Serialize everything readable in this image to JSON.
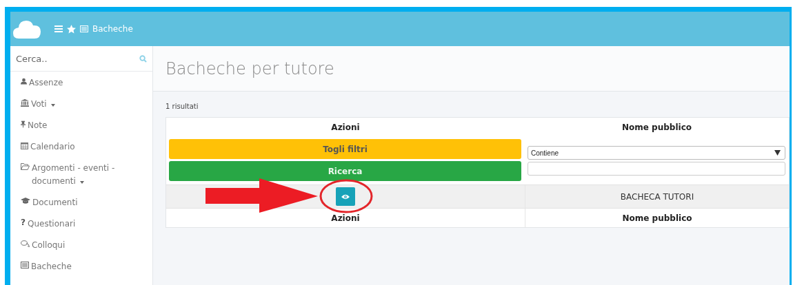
{
  "header": {
    "title": "Bacheche"
  },
  "sidebar": {
    "search": {
      "placeholder": "Cerca.."
    },
    "items": [
      {
        "label": "Assenze",
        "submenu": false
      },
      {
        "label": "Voti",
        "submenu": true
      },
      {
        "label": "Note",
        "submenu": false
      },
      {
        "label": "Calendario",
        "submenu": false
      },
      {
        "label": "Argomenti - eventi - documenti",
        "submenu": true
      },
      {
        "label": "Documenti",
        "submenu": false
      },
      {
        "label": "Questionari",
        "submenu": false,
        "glyph": "?"
      },
      {
        "label": "Colloqui",
        "submenu": false
      },
      {
        "label": "Bacheche",
        "submenu": false
      }
    ]
  },
  "page": {
    "title": "Bacheche per tutore",
    "result_count": "1 risultati",
    "table": {
      "columns": [
        "Azioni",
        "Nome pubblico"
      ],
      "filter_buttons": [
        {
          "label": "Togli filtri",
          "kind": "warning"
        },
        {
          "label": "Ricerca",
          "kind": "success"
        }
      ],
      "filter_select": {
        "value": "Contiene"
      },
      "rows": [
        {
          "nome_pubblico": "BACHECA TUTORI"
        }
      ],
      "footer": [
        "Azioni",
        "Nome pubblico"
      ]
    }
  }
}
